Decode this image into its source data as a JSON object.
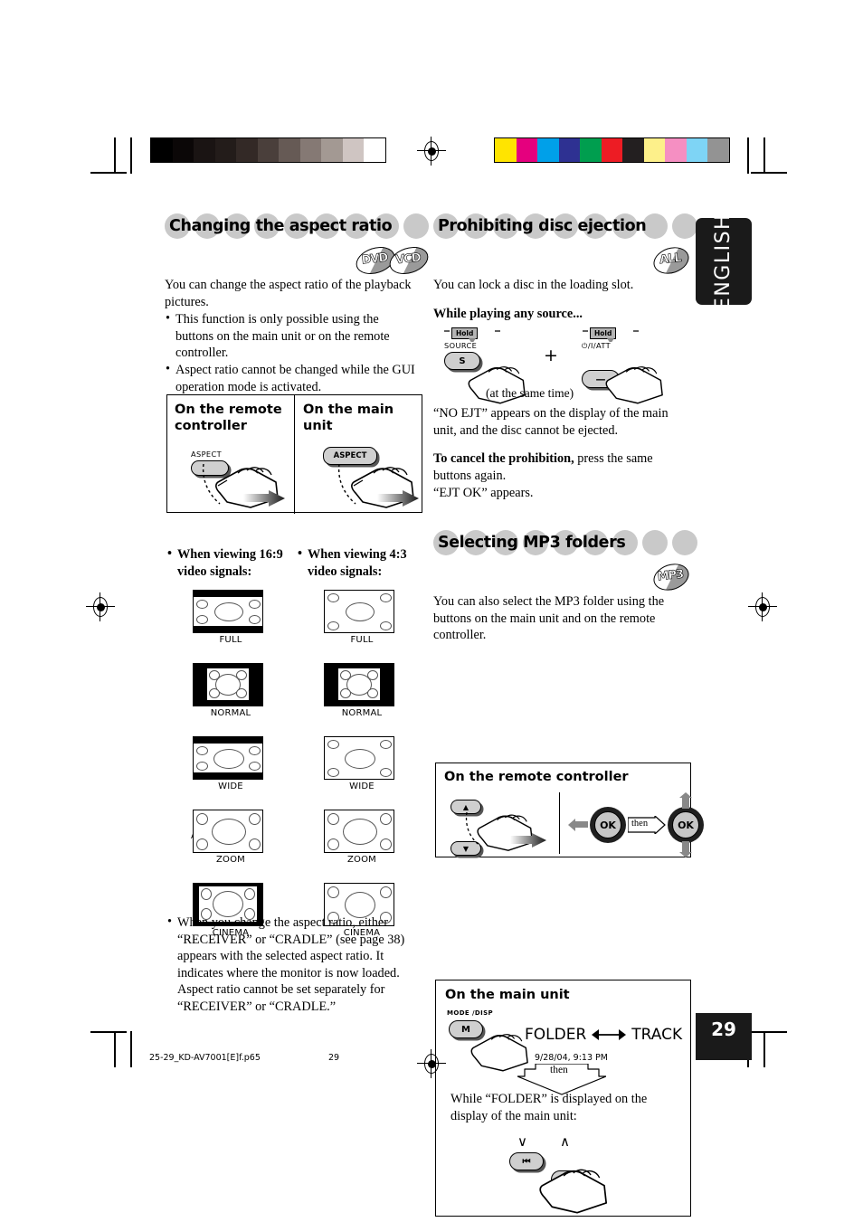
{
  "page": {
    "number": "29",
    "language_tab": "ENGLISH",
    "footer": {
      "filename": "25-29_KD-AV7001[E]f.p65",
      "page_no": "29",
      "timestamp": "9/28/04, 9:13 PM"
    },
    "colorbars": {
      "grayscale": [
        "#000000",
        "#0b0707",
        "#1a1413",
        "#231c1a",
        "#332926",
        "#4a3f3b",
        "#665a55",
        "#857974",
        "#a39993",
        "#cfc5c2",
        "#ffffff"
      ],
      "color": [
        "#ffe400",
        "#e5007e",
        "#00a0e9",
        "#2e3192",
        "#009e4f",
        "#ed1c24",
        "#231f20",
        "#fdf08a",
        "#f58fc2",
        "#7ed4f5",
        "#939393"
      ]
    }
  },
  "left_column": {
    "section": {
      "title": "Changing the aspect ratio",
      "disc_logos": [
        "DVD",
        "VCD"
      ],
      "intro": "You can change the aspect ratio of the playback pictures.",
      "bullets": [
        "This function is only possible using the buttons on the main unit or on the remote controller.",
        "Aspect ratio cannot be changed while the GUI operation mode is activated."
      ]
    },
    "aspect_box": {
      "remote_title": "On the remote controller",
      "remote_button_label": "ASPECT",
      "main_title": "On the main unit",
      "main_button_label": "ASPECT"
    },
    "figure_columns": [
      {
        "heading": "When viewing 16:9 video signals:",
        "figures": [
          {
            "name": "FULL",
            "bands": "top-bottom-thin"
          },
          {
            "name": "NORMAL",
            "bands": "left-right-wide"
          },
          {
            "name": "WIDE",
            "bands": "top-bottom-thin"
          },
          {
            "name": "ZOOM",
            "bands": "none"
          },
          {
            "name": "CINEMA",
            "bands": "left-right-thin"
          }
        ]
      },
      {
        "heading": "When viewing 4:3 video signals:",
        "figures": [
          {
            "name": "FULL",
            "bands": "none"
          },
          {
            "name": "NORMAL",
            "bands": "left-right-wide"
          },
          {
            "name": "WIDE",
            "bands": "none"
          },
          {
            "name": "ZOOM",
            "bands": "none"
          },
          {
            "name": "CINEMA",
            "bands": "none"
          }
        ]
      }
    ],
    "footnote": "When you change the aspect ratio, either “RECEIVER” or “CRADLE” (see page 38) appears with the selected aspect ratio. It indicates where the monitor is now loaded. Aspect ratio cannot be set separately for “RECEIVER” or “CRADLE.”"
  },
  "right_column": {
    "prohibit_section": {
      "title": "Prohibiting disc ejection",
      "disc_logo": "ALL",
      "intro": "You can lock a disc in the loading slot.",
      "subhead": "While playing any source...",
      "hold_tag": "Hold",
      "button_left_label": "SOURCE",
      "button_left_glyph": "S",
      "plus": "+",
      "button_right_label": "⏻/I/ATT",
      "button_right_glyph": "—",
      "same_time_note": "(at the same time)",
      "result_text": "“NO EJT” appears on the display of the main unit, and the disc cannot be ejected.",
      "cancel_bold": "To cancel the prohibition,",
      "cancel_rest": " press the same buttons again.",
      "cancel_result": "“EJT OK” appears."
    },
    "mp3_section": {
      "title": "Selecting MP3 folders",
      "disc_logo": "MP3",
      "intro": "You can also select the MP3 folder using the buttons on the main unit and on the remote controller.",
      "remote_box": {
        "title": "On the remote controller",
        "up_glyph": "▲",
        "down_glyph": "▼",
        "ok_label": "OK",
        "then_label": "then"
      },
      "main_box": {
        "title": "On the main unit",
        "mode_label": "MODE /DISP",
        "mode_glyph": "M",
        "mode_text": "FOLDER ⟷ TRACK",
        "mode_text_left": "FOLDER",
        "mode_text_right": "TRACK",
        "then_label": "then",
        "note": "While “FOLDER” is displayed on the display of the main unit:",
        "prev_glyph": "⏮",
        "next_glyph": "⏭",
        "down_caret": "∨",
        "up_caret": "∧"
      }
    }
  }
}
